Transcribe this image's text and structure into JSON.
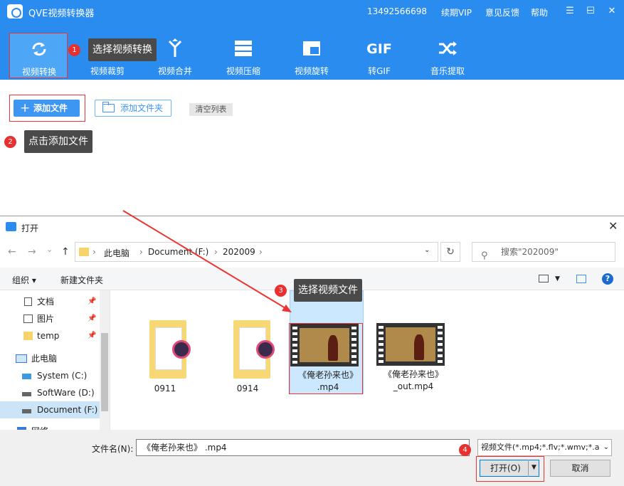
{
  "app": {
    "title": "QVE视频转换器",
    "phone": "13492566698",
    "vip": "续期VIP",
    "feedback": "意见反馈",
    "help": "帮助",
    "window_controls": [
      "☰",
      "─",
      "☐",
      "✕"
    ]
  },
  "tools": [
    {
      "label": "视频转换",
      "icon": "convert-icon"
    },
    {
      "label": "视频裁剪",
      "icon": "crop-icon"
    },
    {
      "label": "视频合并",
      "icon": "merge-icon"
    },
    {
      "label": "视频压缩",
      "icon": "compress-icon"
    },
    {
      "label": "视频旋转",
      "icon": "rotate-icon"
    },
    {
      "label": "转GIF",
      "icon": "gif-icon",
      "glyph": "GIF"
    },
    {
      "label": "音乐提取",
      "icon": "shuffle-icon"
    }
  ],
  "file_toolbar": {
    "add_file": "添加文件",
    "add_folder": "添加文件夹",
    "clear_list": "清空列表"
  },
  "callouts": [
    {
      "num": "1",
      "text": "选择视频转换"
    },
    {
      "num": "2",
      "text": "点击添加文件"
    },
    {
      "num": "3",
      "text": "选择视频文件"
    },
    {
      "num": "4",
      "text": ""
    }
  ],
  "dialog": {
    "title": "打开",
    "close": "✕",
    "nav": {
      "back": "←",
      "forward": "→",
      "recent": "⌄",
      "up": "↑"
    },
    "breadcrumb": [
      "此电脑",
      "Document (F:)",
      "202009"
    ],
    "refresh": "↻",
    "search_placeholder": "搜索\"202009\"",
    "commands": {
      "organize": "组织 ▾",
      "new_folder": "新建文件夹"
    },
    "help_glyph": "?",
    "nav_items": [
      {
        "label": "文档",
        "pinned": true,
        "icon": "document-icon"
      },
      {
        "label": "图片",
        "pinned": true,
        "icon": "picture-icon"
      },
      {
        "label": "temp",
        "pinned": true,
        "icon": "folder-icon"
      },
      {
        "label": "此电脑",
        "pinned": false,
        "icon": "computer-icon"
      },
      {
        "label": "System (C:)",
        "pinned": false,
        "icon": "drive-icon"
      },
      {
        "label": "SoftWare (D:)",
        "pinned": false,
        "icon": "drive-icon"
      },
      {
        "label": "Document (F:)",
        "pinned": false,
        "icon": "drive-icon",
        "selected": true
      },
      {
        "label": "网络",
        "pinned": false,
        "icon": "network-icon"
      }
    ],
    "pin_glyph": "📌",
    "files": [
      {
        "name": "0911",
        "kind": "folder"
      },
      {
        "name": "0914",
        "kind": "folder"
      },
      {
        "name1": "《俺老孙来也》",
        "name2": ".mp4",
        "kind": "video",
        "selected": true
      },
      {
        "name1": "《俺老孙来也》",
        "name2": "_out.mp4",
        "kind": "video"
      }
    ],
    "filename_label": "文件名(N):",
    "filename_value": "《俺老孙来也》 .mp4",
    "filter": "视频文件(*.mp4;*.flv;*.wmv;*.a",
    "open": "打开(O)",
    "cancel": "取消"
  },
  "colors": {
    "brand": "#2b8cf0",
    "callout": "#e8302f",
    "highlight": "#e33"
  }
}
